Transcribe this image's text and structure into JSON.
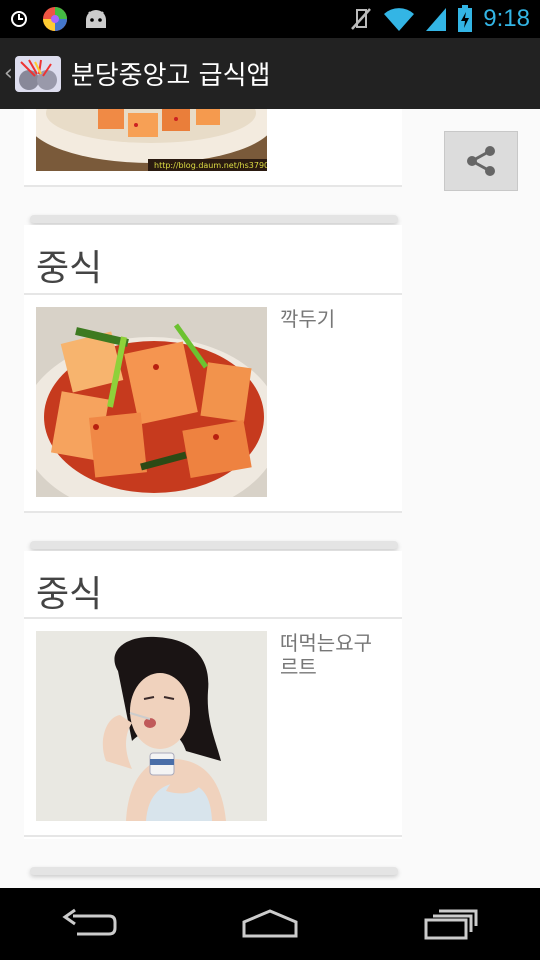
{
  "status_bar": {
    "time": "9:18"
  },
  "action_bar": {
    "title": "분당중앙고 급식앱"
  },
  "cards": [
    {
      "title": "중식",
      "item": "깍두기"
    },
    {
      "title": "중식",
      "item": "떠먹는요구르트"
    }
  ],
  "top_partial_image": {
    "watermark": "http://blog.daum.net/hs3790"
  },
  "colors": {
    "accent": "#33b5e5",
    "action_bar": "#222222",
    "background": "#fafafa"
  }
}
